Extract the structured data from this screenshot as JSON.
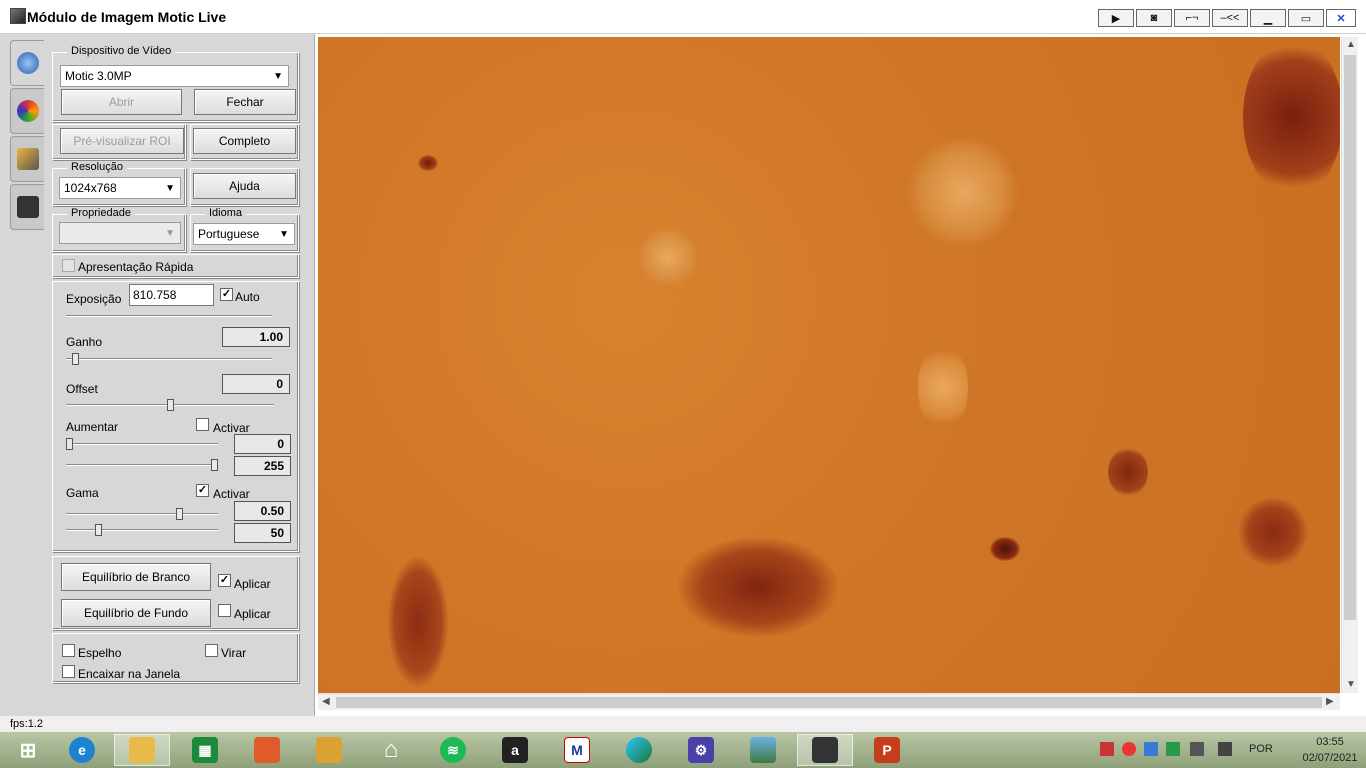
{
  "window": {
    "title": "Módulo de Imagem Motic Live"
  },
  "titlebar_buttons": [
    "play-icon",
    "camera-icon",
    "collapse-icon",
    "rewind-icon",
    "minimize-icon",
    "maximize-icon",
    "close-icon"
  ],
  "device": {
    "legend": "Dispositivo de Vídeo",
    "selected": "Motic 3.0MP",
    "open_label": "Abrir",
    "close_label": "Fechar",
    "preview_roi_label": "Pré-visualizar ROI",
    "full_label": "Completo"
  },
  "resolution": {
    "legend": "Resolução",
    "selected": "1024x768",
    "help_label": "Ajuda"
  },
  "property": {
    "legend": "Propriedade",
    "selected": ""
  },
  "language": {
    "legend": "Idioma",
    "selected": "Portuguese"
  },
  "quick_present": {
    "label": "Apresentação Rápida",
    "checked": false
  },
  "exposure": {
    "label": "Exposição",
    "value": "810.758",
    "auto_label": "Auto",
    "auto_checked": true
  },
  "gain": {
    "label": "Ganho",
    "value": "1.00",
    "level": 0.03
  },
  "offset": {
    "label": "Offset",
    "value": "0",
    "level": 0.5
  },
  "boost": {
    "label": "Aumentar",
    "activate_label": "Activar",
    "activate_checked": false,
    "low_value": "0",
    "high_value": "255",
    "low_level": 0.0,
    "high_level": 1.0
  },
  "gamma": {
    "label": "Gama",
    "activate_label": "Activar",
    "activate_checked": true,
    "value1": "0.50",
    "value2": "50",
    "level1": 0.76,
    "level2": 0.2
  },
  "white_balance": {
    "label": "Equilíbrio de Branco",
    "apply_label": "Aplicar",
    "apply_checked": true
  },
  "background_balance": {
    "label": "Equilíbrio de Fundo",
    "apply_label": "Aplicar",
    "apply_checked": false
  },
  "mirror": {
    "label": "Espelho",
    "checked": false
  },
  "flip": {
    "label": "Virar",
    "checked": false
  },
  "fit_window": {
    "label": "Encaixar na Janela",
    "checked": false
  },
  "status": {
    "fps": "fps:1.2"
  },
  "taskbar": {
    "apps": [
      "start",
      "internet-explorer",
      "file-explorer",
      "microsoft-store",
      "photos",
      "notes",
      "home",
      "spotify",
      "amazon",
      "motic",
      "edge",
      "settings",
      "image-viewer",
      "motic-live",
      "powerpoint"
    ],
    "language": "POR",
    "time": "03:55",
    "date": "02/07/2021"
  },
  "colors": {
    "video_bg": "#cf7527",
    "panel_bg": "#d7d7d7",
    "cell": "#8a2a14"
  }
}
